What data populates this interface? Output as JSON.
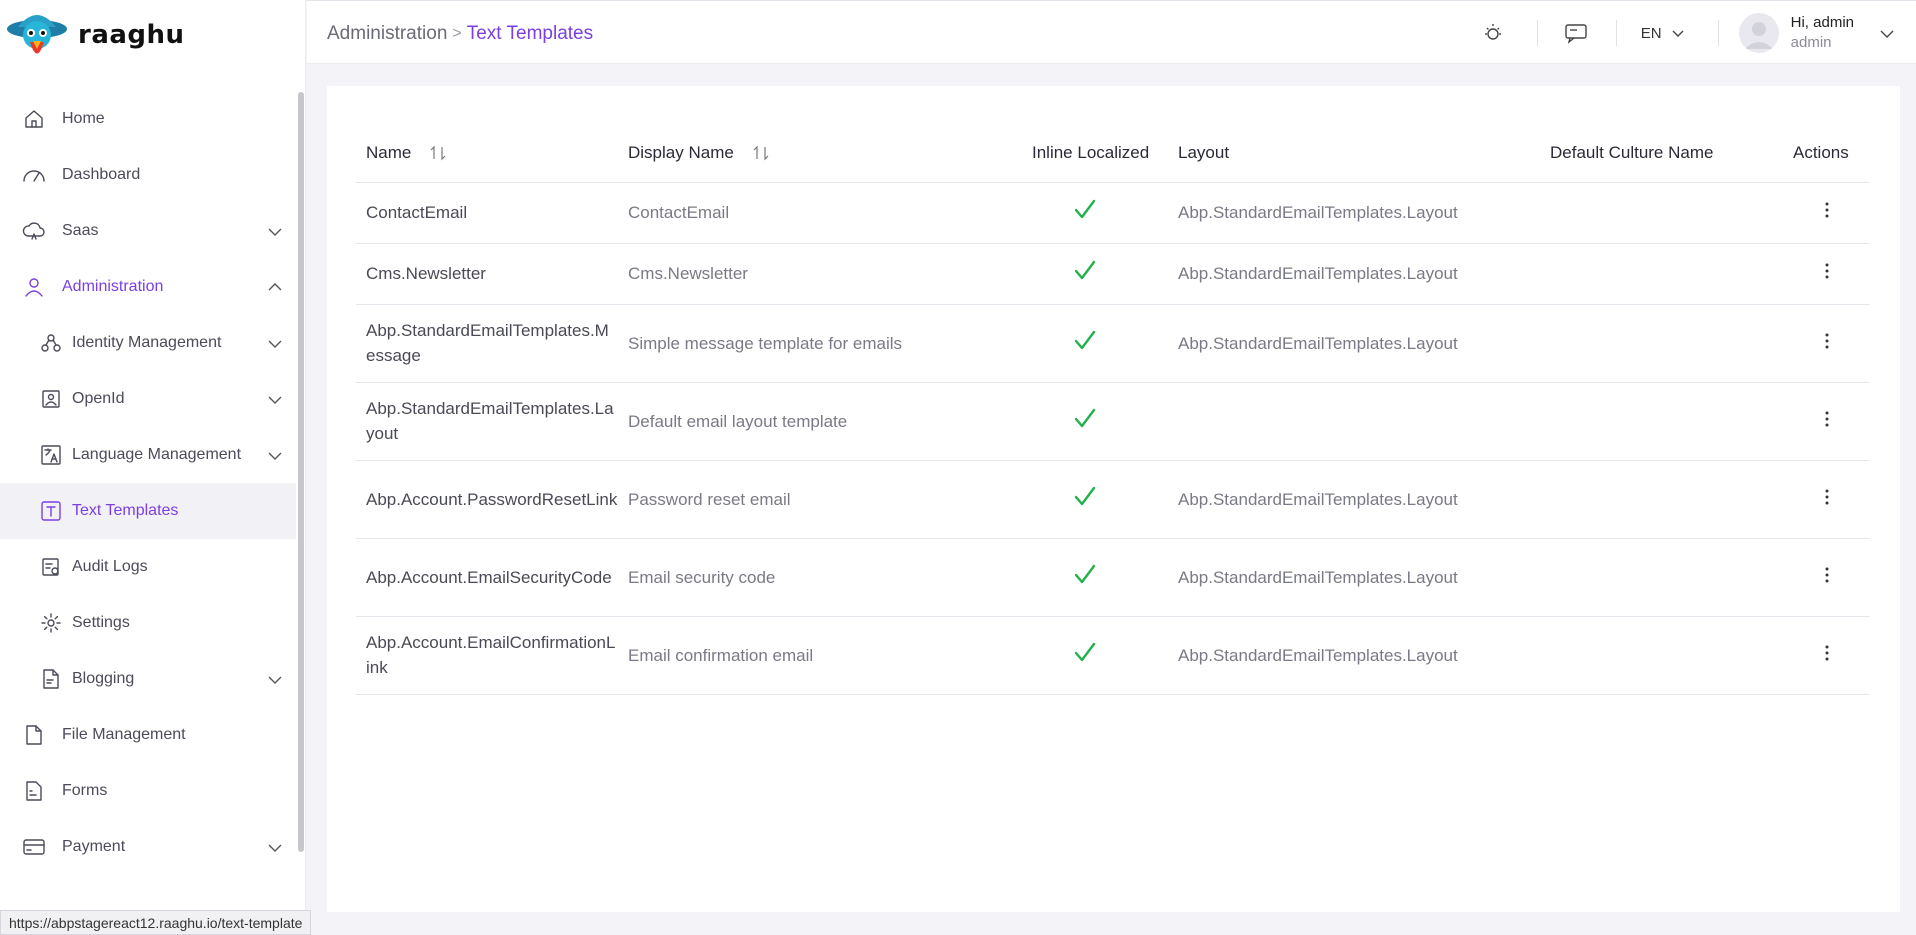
{
  "brand": {
    "name": "raaghu",
    "logo_icon": "parrot-logo-icon"
  },
  "sidebar": {
    "items": [
      {
        "label": "Home",
        "icon": "home-icon",
        "level": 1,
        "expandable": false,
        "state": "normal"
      },
      {
        "label": "Dashboard",
        "icon": "gauge-icon",
        "level": 1,
        "expandable": false,
        "state": "normal"
      },
      {
        "label": "Saas",
        "icon": "cloud-icon",
        "level": 1,
        "expandable": true,
        "expanded": false,
        "state": "normal"
      },
      {
        "label": "Administration",
        "icon": "user-icon",
        "level": 1,
        "expandable": true,
        "expanded": true,
        "state": "active-parent"
      },
      {
        "label": "Identity Management",
        "icon": "users-network-icon",
        "level": 2,
        "expandable": true,
        "expanded": false,
        "state": "normal"
      },
      {
        "label": "OpenId",
        "icon": "id-card-icon",
        "level": 2,
        "expandable": true,
        "expanded": false,
        "state": "normal"
      },
      {
        "label": "Language Management",
        "icon": "translate-icon",
        "level": 2,
        "expandable": true,
        "expanded": false,
        "state": "normal"
      },
      {
        "label": "Text Templates",
        "icon": "text-template-icon",
        "level": 2,
        "expandable": false,
        "state": "selected"
      },
      {
        "label": "Audit Logs",
        "icon": "audit-log-icon",
        "level": 2,
        "expandable": false,
        "state": "normal"
      },
      {
        "label": "Settings",
        "icon": "gear-icon",
        "level": 2,
        "expandable": false,
        "state": "normal"
      },
      {
        "label": "Blogging",
        "icon": "document-icon",
        "level": 2,
        "expandable": true,
        "expanded": false,
        "state": "normal"
      },
      {
        "label": "File Management",
        "icon": "file-icon",
        "level": 1,
        "expandable": false,
        "state": "normal"
      },
      {
        "label": "Forms",
        "icon": "form-icon",
        "level": 1,
        "expandable": false,
        "state": "normal"
      },
      {
        "label": "Payment",
        "icon": "credit-card-icon",
        "level": 1,
        "expandable": true,
        "expanded": false,
        "state": "normal"
      }
    ]
  },
  "header": {
    "breadcrumb": {
      "parent": "Administration",
      "separator": ">",
      "current": "Text Templates"
    },
    "language": "EN",
    "user": {
      "greeting": "Hi, admin",
      "role": "admin"
    },
    "icons": [
      "theme-sun-icon",
      "chat-icon",
      "chevron-down-icon",
      "avatar"
    ]
  },
  "table": {
    "columns": {
      "name": "Name",
      "display_name": "Display Name",
      "inline_localized": "Inline Localized",
      "layout": "Layout",
      "default_culture_name": "Default Culture Name",
      "actions": "Actions"
    },
    "rows": [
      {
        "name": "ContactEmail",
        "display_name": "ContactEmail",
        "inline_localized": true,
        "layout": "Abp.StandardEmailTemplates.Layout",
        "default_culture_name": ""
      },
      {
        "name": "Cms.Newsletter",
        "display_name": "Cms.Newsletter",
        "inline_localized": true,
        "layout": "Abp.StandardEmailTemplates.Layout",
        "default_culture_name": ""
      },
      {
        "name": "Abp.StandardEmailTemplates.Message",
        "display_name": "Simple message template for emails",
        "inline_localized": true,
        "layout": "Abp.StandardEmailTemplates.Layout",
        "default_culture_name": ""
      },
      {
        "name": "Abp.StandardEmailTemplates.Layout",
        "display_name": "Default email layout template",
        "inline_localized": true,
        "layout": "",
        "default_culture_name": ""
      },
      {
        "name": "Abp.Account.PasswordResetLink",
        "display_name": "Password reset email",
        "inline_localized": true,
        "layout": "Abp.StandardEmailTemplates.Layout",
        "default_culture_name": ""
      },
      {
        "name": "Abp.Account.EmailSecurityCode",
        "display_name": "Email security code",
        "inline_localized": true,
        "layout": "Abp.StandardEmailTemplates.Layout",
        "default_culture_name": ""
      },
      {
        "name": "Abp.Account.EmailConfirmationLink",
        "display_name": "Email confirmation email",
        "inline_localized": true,
        "layout": "Abp.StandardEmailTemplates.Layout",
        "default_culture_name": ""
      }
    ]
  },
  "status_bar": {
    "url": "https://abpstagereact12.raaghu.io/text-template"
  },
  "colors": {
    "accent": "#7b3fe4",
    "check": "#22b14c",
    "text_muted": "#7a7a86"
  }
}
